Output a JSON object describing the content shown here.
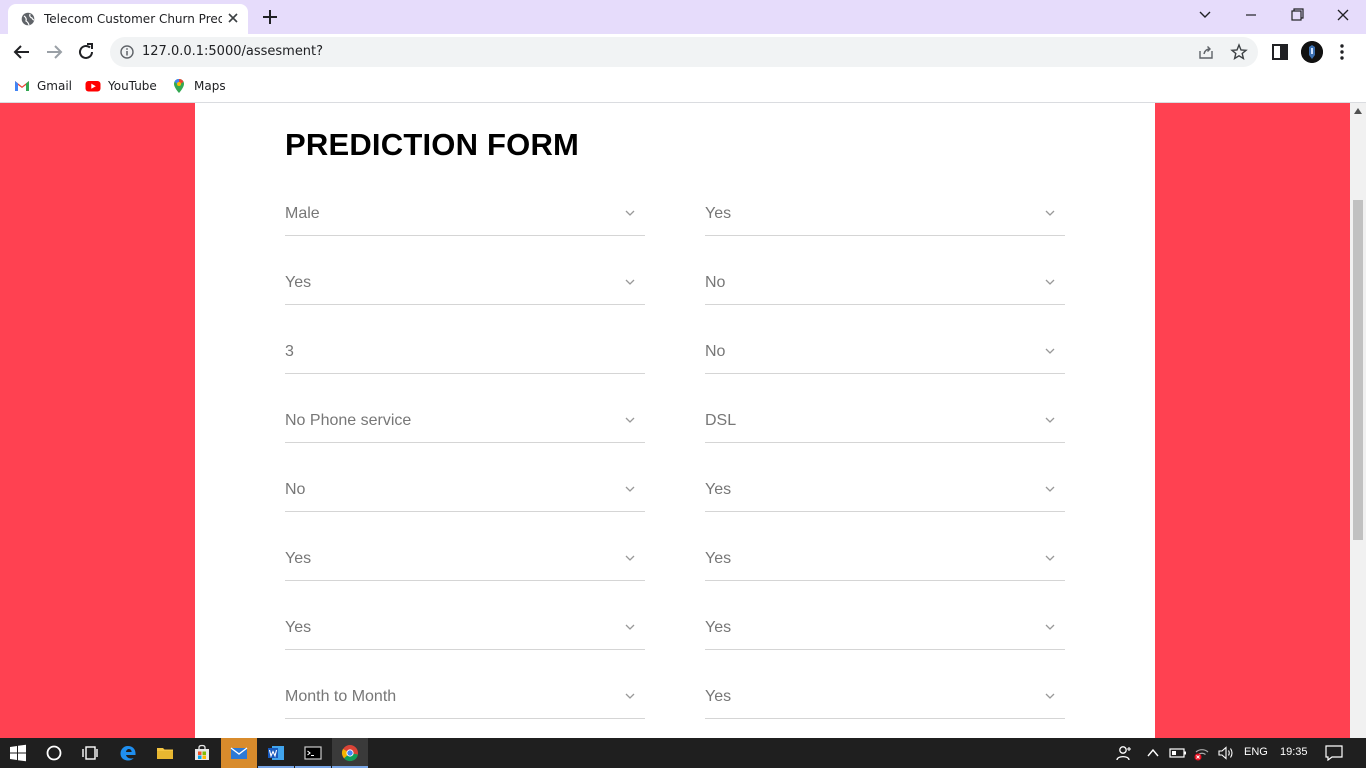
{
  "browser": {
    "tab": {
      "title": "Telecom Customer Churn Predict"
    },
    "address_bar": {
      "url": "127.0.0.1:5000/assesment?"
    },
    "bookmarks": [
      {
        "label": "Gmail",
        "icon": "gmail-icon"
      },
      {
        "label": "YouTube",
        "icon": "youtube-icon"
      },
      {
        "label": "Maps",
        "icon": "maps-icon"
      }
    ]
  },
  "page": {
    "background_color": "#ff4151",
    "title": "PREDICTION FORM",
    "fields": [
      {
        "value": "Male",
        "type": "select"
      },
      {
        "value": "Yes",
        "type": "select"
      },
      {
        "value": "Yes",
        "type": "select"
      },
      {
        "value": "No",
        "type": "select"
      },
      {
        "value": "3",
        "type": "input"
      },
      {
        "value": "No",
        "type": "select"
      },
      {
        "value": "No Phone service",
        "type": "select"
      },
      {
        "value": "DSL",
        "type": "select"
      },
      {
        "value": "No",
        "type": "select"
      },
      {
        "value": "Yes",
        "type": "select"
      },
      {
        "value": "Yes",
        "type": "select"
      },
      {
        "value": "Yes",
        "type": "select"
      },
      {
        "value": "Yes",
        "type": "select"
      },
      {
        "value": "Yes",
        "type": "select"
      },
      {
        "value": "Month to Month",
        "type": "select"
      },
      {
        "value": "Yes",
        "type": "select"
      }
    ]
  },
  "taskbar": {
    "language": "ENG",
    "time": "19:35"
  }
}
